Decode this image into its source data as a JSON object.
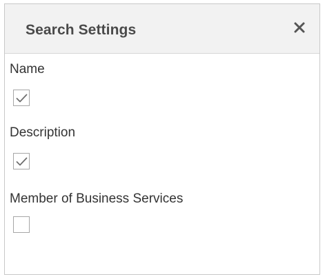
{
  "panel": {
    "title": "Search Settings",
    "close_icon": "close-icon"
  },
  "options": [
    {
      "label": "Name",
      "checked": true
    },
    {
      "label": "Description",
      "checked": true
    },
    {
      "label": "Member of Business Services",
      "checked": false
    }
  ],
  "colors": {
    "header_background": "#f2f2f2",
    "title_text": "#4a4a4a",
    "checkmark": "#6f6f6f",
    "checkbox_border": "#a6a6a6"
  }
}
